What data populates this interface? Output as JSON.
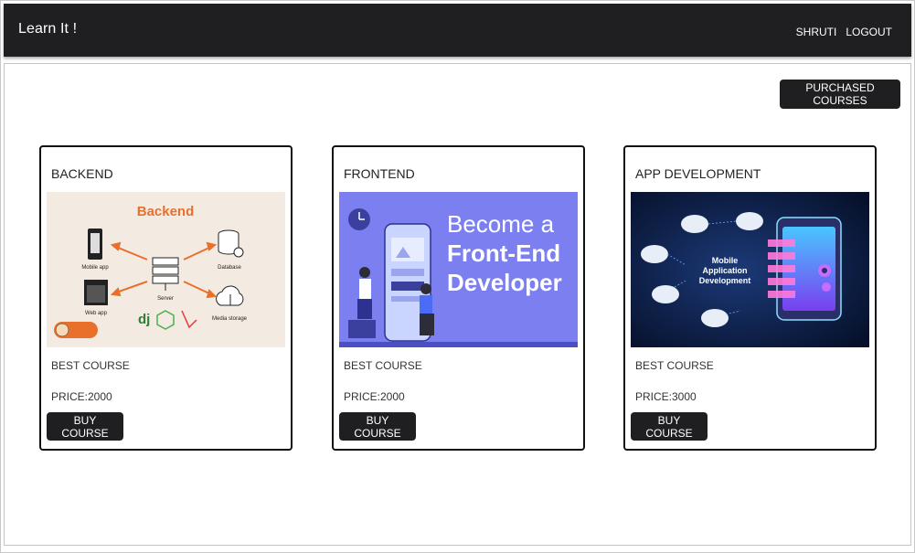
{
  "navbar": {
    "brand": "Learn It !",
    "user_label": "SHRUTI",
    "logout_label": "LOGOUT"
  },
  "purchased_label": "PURCHASED COURSES",
  "courses": [
    {
      "title": "BACKEND",
      "description": "BEST COURSE",
      "price": "PRICE:2000",
      "button": "BUY COURSE",
      "image": {
        "heading": "Backend",
        "labels": [
          "Mobile app",
          "Web app",
          "Server",
          "Database",
          "Media storage"
        ],
        "logos": [
          "dj"
        ]
      }
    },
    {
      "title": "FRONTEND",
      "description": "BEST COURSE",
      "price": "PRICE:2000",
      "button": "BUY COURSE",
      "image": {
        "lines": [
          "Become a",
          "Front-End",
          "Developer"
        ]
      }
    },
    {
      "title": "APP DEVELOPMENT",
      "description": "BEST COURSE",
      "price": "PRICE:3000",
      "button": "BUY COURSE",
      "image": {
        "lines": [
          "Mobile",
          "Application",
          "Development"
        ]
      }
    }
  ],
  "colors": {
    "navbar": "#1f1f22",
    "backend_accent": "#e8702a",
    "frontend_bg": "#7b7ff0",
    "app_bg": "#0b1a3a"
  }
}
